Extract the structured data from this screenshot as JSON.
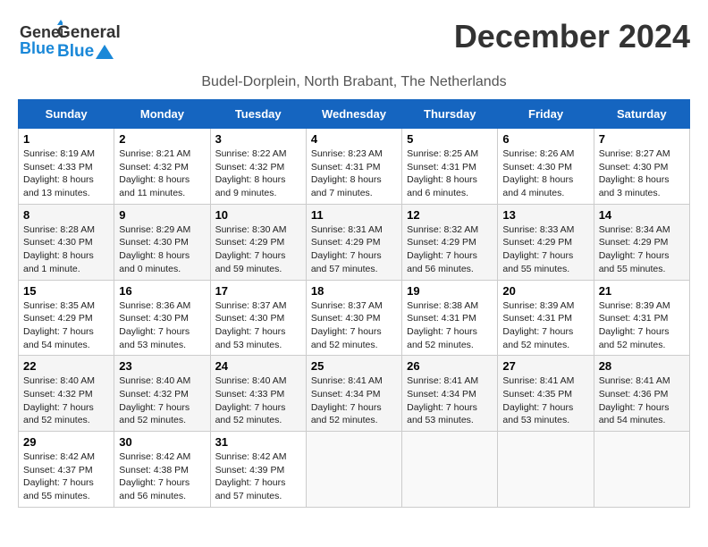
{
  "header": {
    "title": "December 2024",
    "subtitle": "Budel-Dorplein, North Brabant, The Netherlands",
    "logo_general": "General",
    "logo_blue": "Blue"
  },
  "weekdays": [
    "Sunday",
    "Monday",
    "Tuesday",
    "Wednesday",
    "Thursday",
    "Friday",
    "Saturday"
  ],
  "weeks": [
    [
      {
        "day": "1",
        "sunrise": "8:19 AM",
        "sunset": "4:33 PM",
        "daylight": "8 hours and 13 minutes."
      },
      {
        "day": "2",
        "sunrise": "8:21 AM",
        "sunset": "4:32 PM",
        "daylight": "8 hours and 11 minutes."
      },
      {
        "day": "3",
        "sunrise": "8:22 AM",
        "sunset": "4:32 PM",
        "daylight": "8 hours and 9 minutes."
      },
      {
        "day": "4",
        "sunrise": "8:23 AM",
        "sunset": "4:31 PM",
        "daylight": "8 hours and 7 minutes."
      },
      {
        "day": "5",
        "sunrise": "8:25 AM",
        "sunset": "4:31 PM",
        "daylight": "8 hours and 6 minutes."
      },
      {
        "day": "6",
        "sunrise": "8:26 AM",
        "sunset": "4:30 PM",
        "daylight": "8 hours and 4 minutes."
      },
      {
        "day": "7",
        "sunrise": "8:27 AM",
        "sunset": "4:30 PM",
        "daylight": "8 hours and 3 minutes."
      }
    ],
    [
      {
        "day": "8",
        "sunrise": "8:28 AM",
        "sunset": "4:30 PM",
        "daylight": "8 hours and 1 minute."
      },
      {
        "day": "9",
        "sunrise": "8:29 AM",
        "sunset": "4:30 PM",
        "daylight": "8 hours and 0 minutes."
      },
      {
        "day": "10",
        "sunrise": "8:30 AM",
        "sunset": "4:29 PM",
        "daylight": "7 hours and 59 minutes."
      },
      {
        "day": "11",
        "sunrise": "8:31 AM",
        "sunset": "4:29 PM",
        "daylight": "7 hours and 57 minutes."
      },
      {
        "day": "12",
        "sunrise": "8:32 AM",
        "sunset": "4:29 PM",
        "daylight": "7 hours and 56 minutes."
      },
      {
        "day": "13",
        "sunrise": "8:33 AM",
        "sunset": "4:29 PM",
        "daylight": "7 hours and 55 minutes."
      },
      {
        "day": "14",
        "sunrise": "8:34 AM",
        "sunset": "4:29 PM",
        "daylight": "7 hours and 55 minutes."
      }
    ],
    [
      {
        "day": "15",
        "sunrise": "8:35 AM",
        "sunset": "4:29 PM",
        "daylight": "7 hours and 54 minutes."
      },
      {
        "day": "16",
        "sunrise": "8:36 AM",
        "sunset": "4:30 PM",
        "daylight": "7 hours and 53 minutes."
      },
      {
        "day": "17",
        "sunrise": "8:37 AM",
        "sunset": "4:30 PM",
        "daylight": "7 hours and 53 minutes."
      },
      {
        "day": "18",
        "sunrise": "8:37 AM",
        "sunset": "4:30 PM",
        "daylight": "7 hours and 52 minutes."
      },
      {
        "day": "19",
        "sunrise": "8:38 AM",
        "sunset": "4:31 PM",
        "daylight": "7 hours and 52 minutes."
      },
      {
        "day": "20",
        "sunrise": "8:39 AM",
        "sunset": "4:31 PM",
        "daylight": "7 hours and 52 minutes."
      },
      {
        "day": "21",
        "sunrise": "8:39 AM",
        "sunset": "4:31 PM",
        "daylight": "7 hours and 52 minutes."
      }
    ],
    [
      {
        "day": "22",
        "sunrise": "8:40 AM",
        "sunset": "4:32 PM",
        "daylight": "7 hours and 52 minutes."
      },
      {
        "day": "23",
        "sunrise": "8:40 AM",
        "sunset": "4:32 PM",
        "daylight": "7 hours and 52 minutes."
      },
      {
        "day": "24",
        "sunrise": "8:40 AM",
        "sunset": "4:33 PM",
        "daylight": "7 hours and 52 minutes."
      },
      {
        "day": "25",
        "sunrise": "8:41 AM",
        "sunset": "4:34 PM",
        "daylight": "7 hours and 52 minutes."
      },
      {
        "day": "26",
        "sunrise": "8:41 AM",
        "sunset": "4:34 PM",
        "daylight": "7 hours and 53 minutes."
      },
      {
        "day": "27",
        "sunrise": "8:41 AM",
        "sunset": "4:35 PM",
        "daylight": "7 hours and 53 minutes."
      },
      {
        "day": "28",
        "sunrise": "8:41 AM",
        "sunset": "4:36 PM",
        "daylight": "7 hours and 54 minutes."
      }
    ],
    [
      {
        "day": "29",
        "sunrise": "8:42 AM",
        "sunset": "4:37 PM",
        "daylight": "7 hours and 55 minutes."
      },
      {
        "day": "30",
        "sunrise": "8:42 AM",
        "sunset": "4:38 PM",
        "daylight": "7 hours and 56 minutes."
      },
      {
        "day": "31",
        "sunrise": "8:42 AM",
        "sunset": "4:39 PM",
        "daylight": "7 hours and 57 minutes."
      },
      null,
      null,
      null,
      null
    ]
  ]
}
